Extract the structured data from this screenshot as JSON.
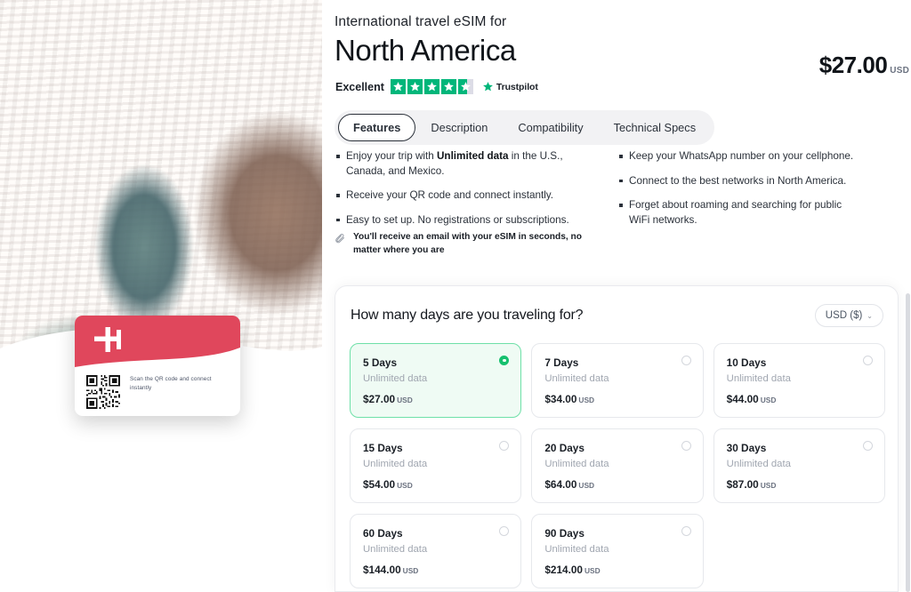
{
  "product": {
    "eyebrow": "International travel eSIM for",
    "title": "North America",
    "price_amount": "$27.00",
    "price_currency": "USD"
  },
  "trustpilot": {
    "rating_word": "Excellent",
    "brand": "Trustpilot",
    "stars_filled": 4,
    "partial_star_fraction": 0.58,
    "star_count": 5
  },
  "tabs": [
    {
      "label": "Features",
      "active": true
    },
    {
      "label": "Description",
      "active": false
    },
    {
      "label": "Compatibility",
      "active": false
    },
    {
      "label": "Technical Specs",
      "active": false
    }
  ],
  "features": {
    "left": [
      {
        "pre": "Enjoy your trip with ",
        "bold": "Unlimited data",
        "post": " in the U.S., Canada, and Mexico."
      },
      {
        "pre": "Receive your QR code and connect instantly.",
        "bold": "",
        "post": ""
      },
      {
        "pre": "Easy to set up. No registrations or subscriptions.",
        "bold": "",
        "post": ""
      }
    ],
    "right": [
      {
        "pre": "Keep your WhatsApp number on your cellphone.",
        "bold": "",
        "post": ""
      },
      {
        "pre": "Connect to the best networks in North America.",
        "bold": "",
        "post": ""
      },
      {
        "pre": "Forget about roaming and searching for public WiFi networks.",
        "bold": "",
        "post": ""
      }
    ],
    "note": "You'll receive an email with your eSIM in seconds, no matter where you are"
  },
  "promo_card": {
    "logo_letter": "H",
    "caption": "Scan the QR code and connect instantly",
    "brand_color": "#e0475c"
  },
  "plans_panel": {
    "title": "How many days are you traveling for?",
    "currency_selector": "USD ($)",
    "currency_chevron": "⌄",
    "data_label": "Unlimited data",
    "price_currency": "USD",
    "plans": [
      {
        "days": "5 Days",
        "data": "Unlimited data",
        "price": "$27.00",
        "currency": "USD",
        "selected": true
      },
      {
        "days": "7 Days",
        "data": "Unlimited data",
        "price": "$34.00",
        "currency": "USD",
        "selected": false
      },
      {
        "days": "10 Days",
        "data": "Unlimited data",
        "price": "$44.00",
        "currency": "USD",
        "selected": false
      },
      {
        "days": "15 Days",
        "data": "Unlimited data",
        "price": "$54.00",
        "currency": "USD",
        "selected": false
      },
      {
        "days": "20 Days",
        "data": "Unlimited data",
        "price": "$64.00",
        "currency": "USD",
        "selected": false
      },
      {
        "days": "30 Days",
        "data": "Unlimited data",
        "price": "$87.00",
        "currency": "USD",
        "selected": false
      },
      {
        "days": "60 Days",
        "data": "Unlimited data",
        "price": "$144.00",
        "currency": "USD",
        "selected": false
      },
      {
        "days": "90 Days",
        "data": "Unlimited data",
        "price": "$214.00",
        "currency": "USD",
        "selected": false
      }
    ]
  },
  "colors": {
    "accent_green": "#16c06e",
    "trustpilot_green": "#00b67a",
    "brand_red": "#e0475c",
    "text_dark": "#1a1f26",
    "muted": "#a0a6b0"
  }
}
